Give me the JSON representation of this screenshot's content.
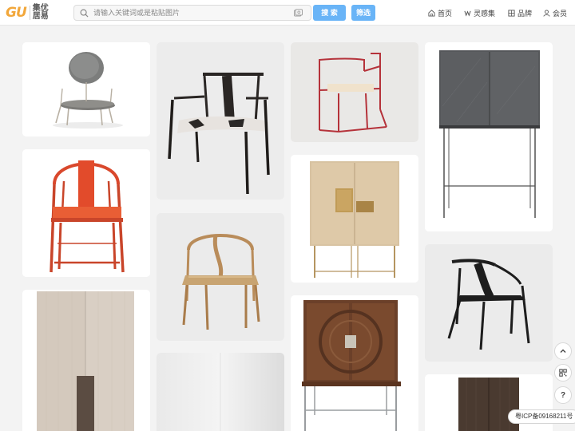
{
  "header": {
    "logo_mark": "GU",
    "logo_text": "集优居易",
    "search_placeholder": "请输入关键词或是粘贴图片",
    "search_button": "搜 索",
    "filter_button": "筛选",
    "nav": [
      {
        "label": "首页",
        "icon": "home-icon"
      },
      {
        "label": "灵感集",
        "icon": "inspiration-icon"
      },
      {
        "label": "品牌",
        "icon": "brand-icon"
      },
      {
        "label": "会员",
        "icon": "user-icon"
      }
    ]
  },
  "gallery": {
    "items": [
      {
        "subject": "round-back-lounge-chair"
      },
      {
        "subject": "orange-ming-chair"
      },
      {
        "subject": "wood-panel-wardrobe"
      },
      {
        "subject": "dark-wood-armchair"
      },
      {
        "subject": "wishbone-chair"
      },
      {
        "subject": "white-panel"
      },
      {
        "subject": "red-frame-chair"
      },
      {
        "subject": "brass-cabinet"
      },
      {
        "subject": "carved-wood-bar-cabinet"
      },
      {
        "subject": "stone-bar-cabinet"
      },
      {
        "subject": "black-bentwood-chair"
      },
      {
        "subject": "dark-wood-cabinet"
      }
    ]
  },
  "side_tools": {
    "scroll_top_icon": "chevron-up-icon",
    "qr_icon": "qr-code-icon",
    "help_label": "?",
    "icp": "粤ICP备09168211号"
  },
  "colors": {
    "accent": "#69b4f7",
    "logo": "#f2a73b",
    "background": "#f3f3f3"
  }
}
